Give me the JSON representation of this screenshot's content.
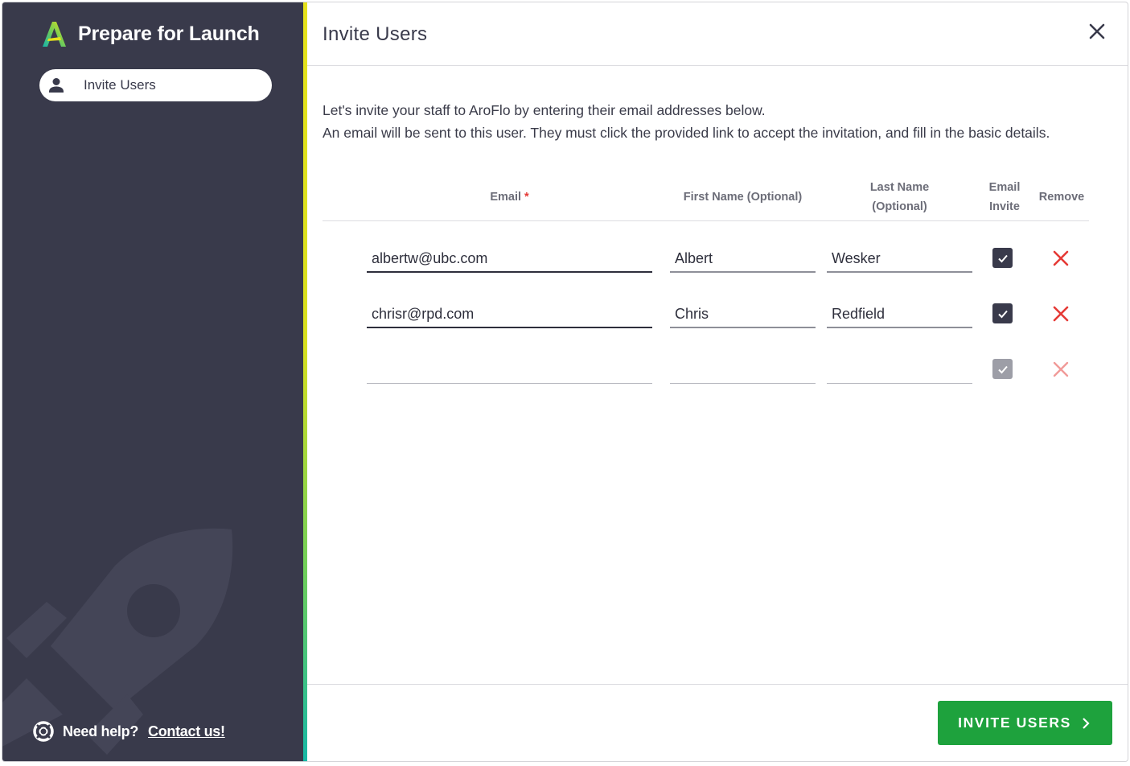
{
  "sidebar": {
    "brand_title": "Prepare for Launch",
    "nav_items": [
      {
        "label": "Invite Users",
        "icon": "person-icon",
        "active": true
      }
    ],
    "help": {
      "text": "Need help?",
      "link": "Contact us!"
    }
  },
  "header": {
    "title": "Invite Users"
  },
  "intro": {
    "line1": "Let's invite your staff to AroFlo by entering their email addresses below.",
    "line2": "An email will be sent to this user. They must click the provided link to accept the invitation, and fill in the basic details."
  },
  "table": {
    "headers": {
      "email": "Email",
      "email_required": "*",
      "first_name": "First Name (Optional)",
      "last_name_l1": "Last Name",
      "last_name_l2": "(Optional)",
      "email_invite_l1": "Email",
      "email_invite_l2": "Invite",
      "remove": "Remove"
    },
    "rows": [
      {
        "email": "albertw@ubc.com",
        "first_name": "Albert",
        "last_name": "Wesker",
        "email_invite": true
      },
      {
        "email": "chrisr@rpd.com",
        "first_name": "Chris",
        "last_name": "Redfield",
        "email_invite": true
      },
      {
        "email": "",
        "first_name": "",
        "last_name": "",
        "email_invite": true
      }
    ]
  },
  "footer": {
    "invite_button": "INVITE USERS"
  },
  "colors": {
    "sidebar_bg": "#393a4b",
    "accent_yellow": "#e6e21c",
    "accent_teal": "#16b8a6",
    "primary_green": "#1ea23d",
    "remove_red": "#e53935"
  }
}
